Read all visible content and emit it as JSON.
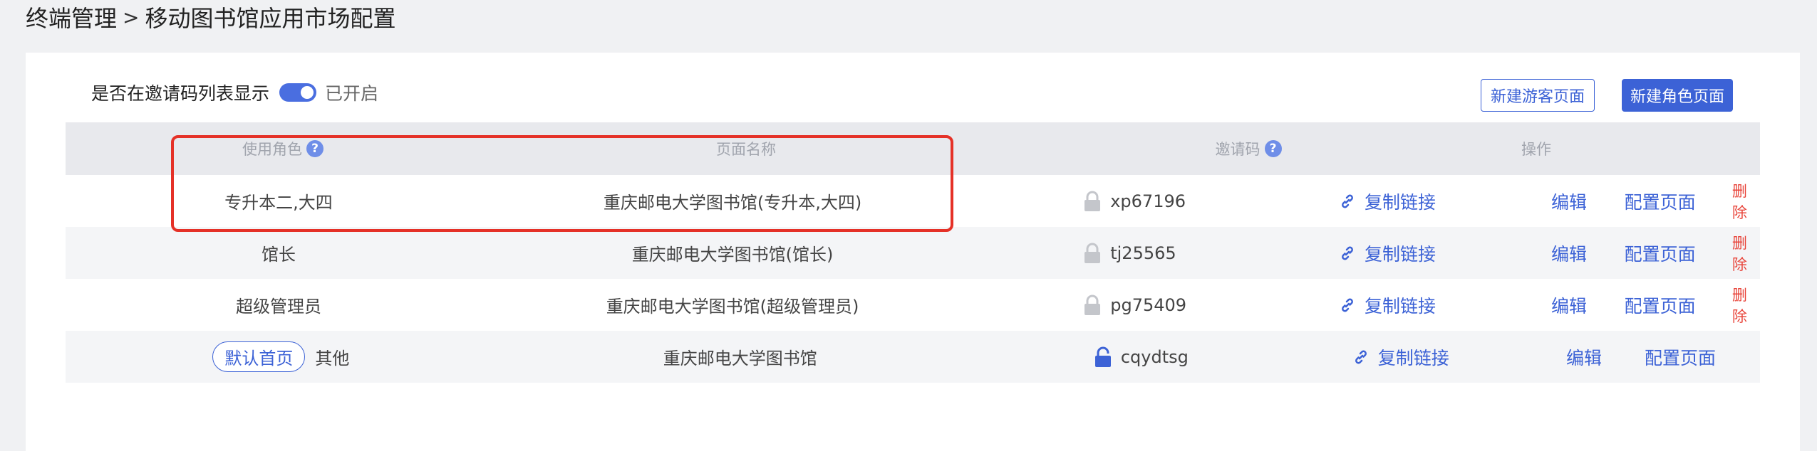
{
  "breadcrumb": {
    "parent": "终端管理",
    "separator": ">",
    "current": "移动图书馆应用市场配置"
  },
  "toggle": {
    "label": "是否在邀请码列表显示",
    "state_text": "已开启",
    "on": true
  },
  "buttons": {
    "new_guest": "新建游客页面",
    "new_role": "新建角色页面"
  },
  "table": {
    "headers": {
      "role": "使用角色",
      "name": "页面名称",
      "code": "邀请码",
      "ops": "操作",
      "help_glyph": "?"
    },
    "rows": [
      {
        "tag": "",
        "role": "专升本二,大四",
        "name": "重庆邮电大学图书馆(专升本,大四)",
        "code": "xp67196",
        "copy": "复制链接",
        "edit": "编辑",
        "config": "配置页面",
        "delete": "删除",
        "lock": "locked"
      },
      {
        "tag": "",
        "role": "馆长",
        "name": "重庆邮电大学图书馆(馆长)",
        "code": "tj25565",
        "copy": "复制链接",
        "edit": "编辑",
        "config": "配置页面",
        "delete": "删除",
        "lock": "locked"
      },
      {
        "tag": "",
        "role": "超级管理员",
        "name": "重庆邮电大学图书馆(超级管理员)",
        "code": "pg75409",
        "copy": "复制链接",
        "edit": "编辑",
        "config": "配置页面",
        "delete": "删除",
        "lock": "locked"
      },
      {
        "tag": "默认首页",
        "role": "其他",
        "name": "重庆邮电大学图书馆",
        "code": "cqydtsg",
        "copy": "复制链接",
        "edit": "编辑",
        "config": "配置页面",
        "delete": "",
        "lock": "unlocked"
      }
    ]
  },
  "colors": {
    "accent": "#3c62d6",
    "danger": "#e8443a",
    "highlight_border": "#e53127",
    "lock_gray": "#c4c6cb"
  }
}
